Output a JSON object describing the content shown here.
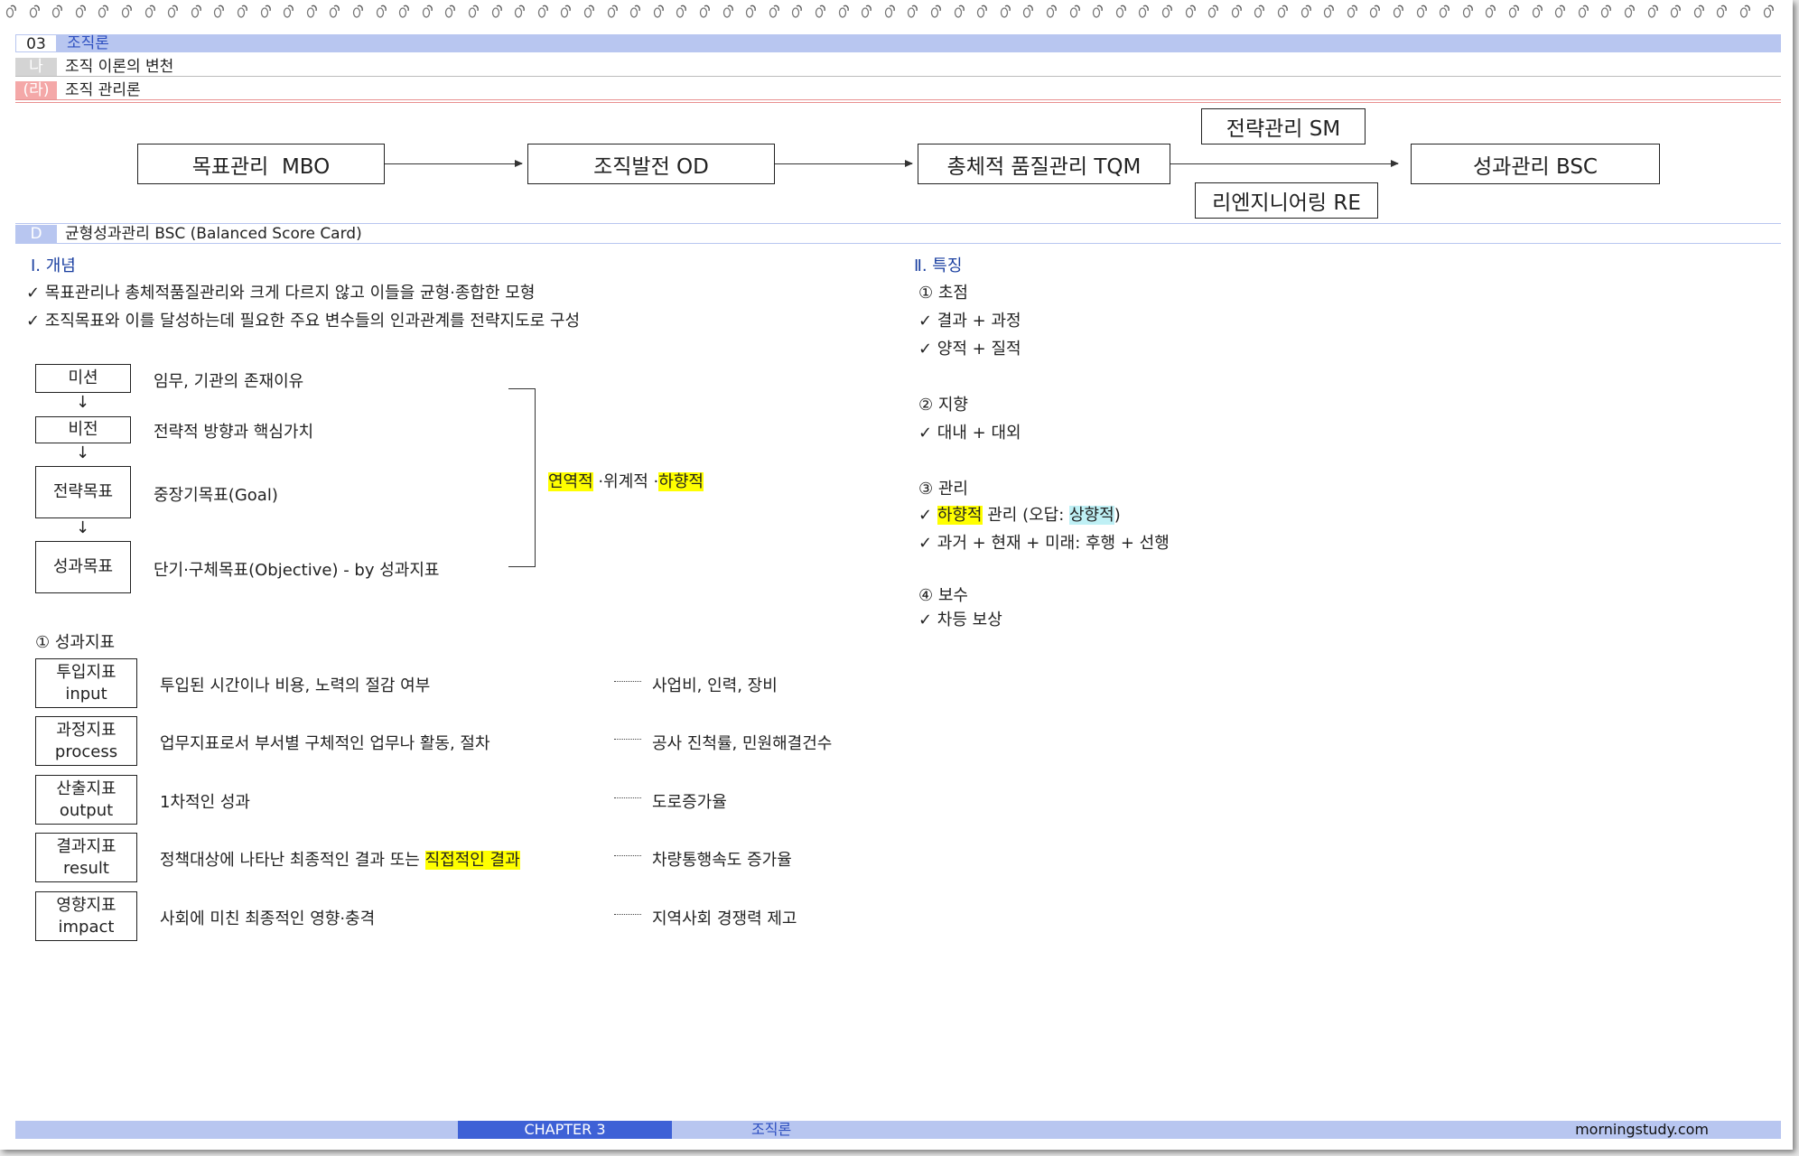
{
  "section": {
    "num": "03",
    "title": "조직론"
  },
  "subsection": {
    "tag": "나",
    "title": "조직 이론의 변천"
  },
  "subsubsection": {
    "tag": "(라)",
    "title": "조직 관리론"
  },
  "flow": {
    "mbo": "목표관리  MBO",
    "od": "조직발전 OD",
    "tqm": "총체적 품질관리 TQM",
    "sm": "전략관리 SM",
    "re": "리엔지니어링 RE",
    "bsc": "성과관리 BSC"
  },
  "bsc_header": {
    "tag": "D",
    "title": "균형성과관리 BSC (Balanced Score Card)"
  },
  "concept": {
    "heading": "Ⅰ. 개념",
    "items": [
      "✓ 목표관리나 총체적품질관리와 크게 다르지 않고 이들을 균형·종합한 모형",
      "✓ 조직목표와 이를 달성하는데 필요한 주요 변수들의 인과관계를 전략지도로 구성"
    ]
  },
  "hierarchy": {
    "items": [
      {
        "label": "미션",
        "desc": "임무, 기관의 존재이유"
      },
      {
        "label": "비전",
        "desc": "전략적 방향과 핵심가치"
      },
      {
        "label": "전략목표",
        "desc": "중장기목표(Goal)"
      },
      {
        "label": "성과목표",
        "desc": "단기·구체목표(Objective) - by 성과지표"
      }
    ],
    "arrow": "↓",
    "bracket": {
      "a": "연역적",
      "b": " ·위계적  ·",
      "c": "하향적"
    }
  },
  "indicators": {
    "heading": "① 성과지표",
    "dots": "··········",
    "rows": [
      {
        "ko": "투입지표",
        "en": "input",
        "desc": "투입된 시간이나 비용, 노력의 절감 여부",
        "ex": "사업비, 인력, 장비"
      },
      {
        "ko": "과정지표",
        "en": "process",
        "desc": "업무지표로서 부서별 구체적인 업무나 활동, 절차",
        "ex": "공사 진척률, 민원해결건수"
      },
      {
        "ko": "산출지표",
        "en": "output",
        "desc": "1차적인 성과",
        "ex": "도로증가율"
      },
      {
        "ko": "결과지표",
        "en": "result",
        "desc": "정책대상에 나타난 최종적인 결과 또는 ",
        "desc_hl": "직접적인 결과",
        "ex": "차량통행속도 증가율"
      },
      {
        "ko": "영향지표",
        "en": "impact",
        "desc": "사회에 미친 최종적인 영향·충격",
        "ex": "지역사회 경쟁력 제고"
      }
    ]
  },
  "features": {
    "heading": "Ⅱ. 특징",
    "focus": {
      "title": "① 초점",
      "items": [
        "✓ 결과 + 과정",
        "✓ 양적 + 질적"
      ]
    },
    "orient": {
      "title": "② 지향",
      "items": [
        "✓ 대내 + 대외"
      ]
    },
    "manage": {
      "title": "③ 관리",
      "line1": {
        "check": "✓ ",
        "hl": "하향적",
        "mid": " 관리  (오답: ",
        "hl2": "상향적",
        "end": ")"
      },
      "line2": "✓ 과거 + 현재 + 미래: 후행 + 선행"
    },
    "reward": {
      "title": "④ 보수",
      "items": [
        "✓ 차등 보상"
      ]
    }
  },
  "footer": {
    "chapter": "CHAPTER 3",
    "title": "조직론",
    "site": "morningstudy.com"
  },
  "colors": {
    "accent": "#b8c6f0",
    "chapter_bg": "#3e61d6",
    "highlight_yellow": "#ffff00",
    "highlight_cyan": "#bff0f5",
    "pink": "#f4a8a8"
  }
}
